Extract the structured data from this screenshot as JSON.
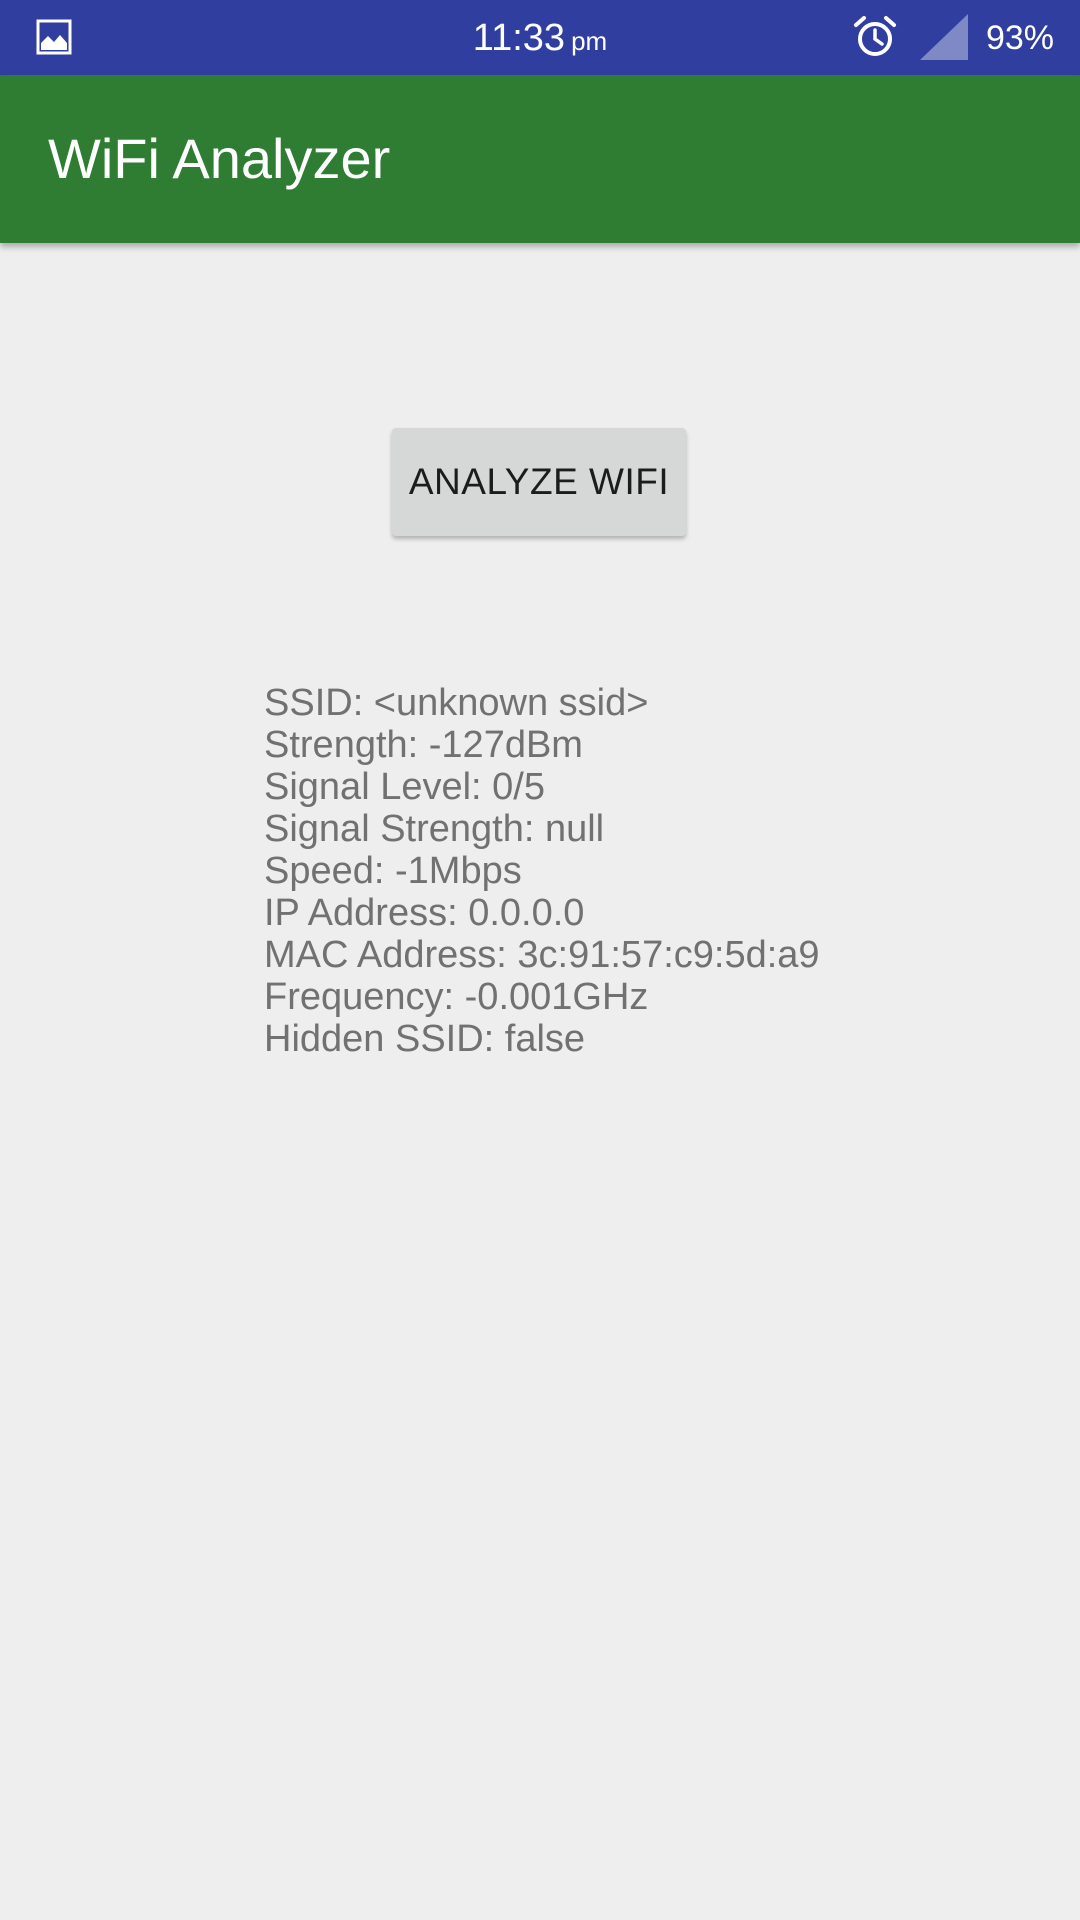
{
  "status_bar": {
    "time": "11:33",
    "ampm": "pm",
    "battery": "93%",
    "icons": [
      "gallery-icon",
      "alarm-icon",
      "signal-icon"
    ],
    "color": "#303f9f"
  },
  "app_bar": {
    "title": "WiFi Analyzer",
    "color": "#2e7d32"
  },
  "main": {
    "analyze_button_label": "ANALYZE WIFI",
    "info": {
      "ssid": "SSID: <unknown ssid>",
      "strength": "Strength: -127dBm",
      "signal_level": "Signal Level: 0/5",
      "signal_strength": "Signal Strength: null",
      "speed": "Speed: -1Mbps",
      "ip_address": "IP Address: 0.0.0.0",
      "mac_address": "MAC Address: 3c:91:57:c9:5d:a9",
      "frequency": "Frequency: -0.001GHz",
      "hidden_ssid": "Hidden SSID: false"
    }
  },
  "colors": {
    "background": "#eeeeee",
    "button": "#d6d7d7",
    "info_text": "#717171"
  }
}
